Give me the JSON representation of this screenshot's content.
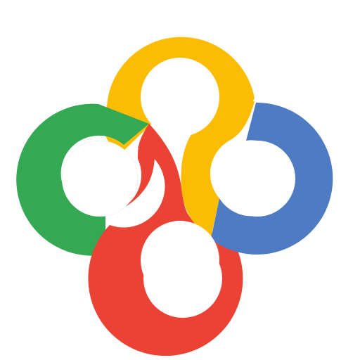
{
  "logo": {
    "icon": "four-color-interlocking-rings-logo",
    "colors": {
      "yellow": "#FBBC04",
      "green": "#34A853",
      "red": "#EA4335",
      "blue": "#4F7BC2",
      "background": "#FFFFFF"
    }
  }
}
